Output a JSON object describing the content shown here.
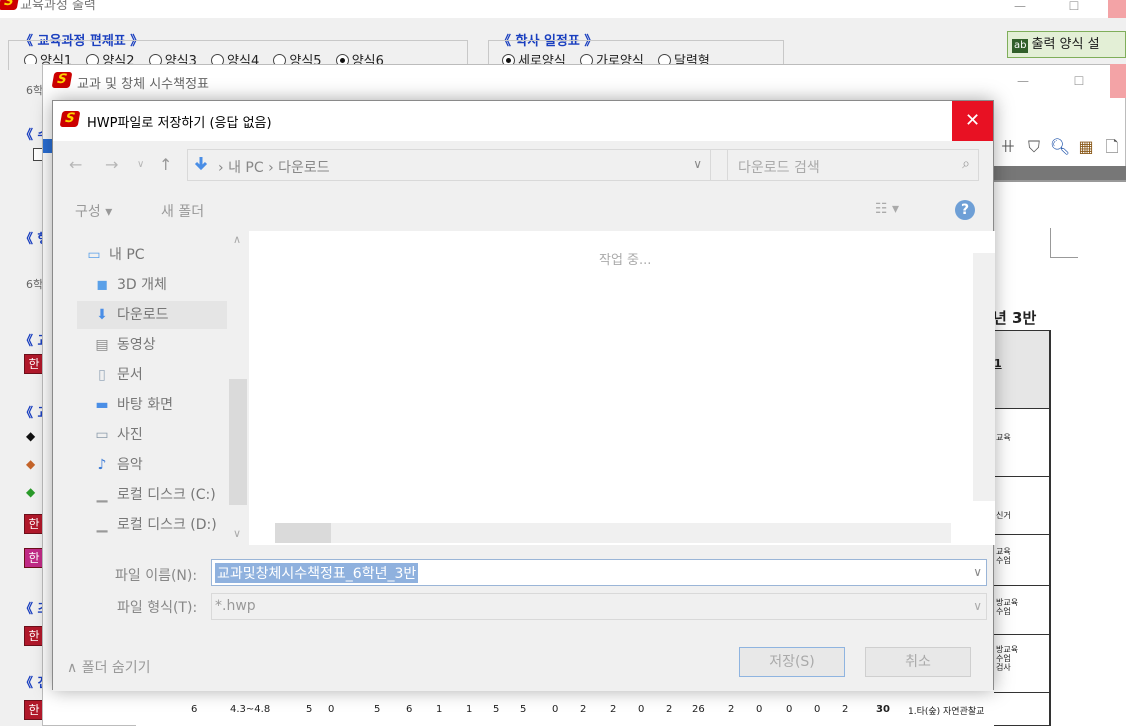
{
  "main_window": {
    "title": "교육과정 출력",
    "curriculum_group": {
      "label": "《 교육과정 편제표 》",
      "options": [
        "양식1",
        "양식2",
        "양식3",
        "양식4",
        "양식5",
        "양식6"
      ],
      "selected": "양식6"
    },
    "schedule_group": {
      "label": "《 학사 일정표 》",
      "options": [
        "세로양식",
        "가로양식",
        "달력형"
      ],
      "selected": "세로양식"
    },
    "print_settings_button": "출력 양식 설",
    "print_settings_badge": "ab",
    "side_labels": [
      "6학",
      "《 수",
      "《 행",
      "6학",
      "《 교",
      "《 교",
      "《 즈",
      "《 진"
    ],
    "red_button_glyph": "한"
  },
  "second_window": {
    "title": "교과 및 창체 시수책정표",
    "class_label": "년 3반",
    "table_cells": [
      "1",
      "교육",
      "신거",
      "교육\n수업",
      "방교육\n수업",
      "방교육\n수업\n검사"
    ],
    "bottom_row": [
      "6",
      "4.3~4.8",
      "5",
      "0",
      "5",
      "6",
      "1",
      "1",
      "5",
      "5",
      "0",
      "2",
      "2",
      "0",
      "2",
      "26",
      "2",
      "0",
      "0",
      "0",
      "2",
      "30",
      "1.타(숲) 자연관찰교"
    ]
  },
  "dialog": {
    "title": "HWP파일로 저장하기 (응답 없음)",
    "address_path": [
      "내 PC",
      "다운로드"
    ],
    "search_placeholder": "다운로드 검색",
    "commands": {
      "organize": "구성 ▾",
      "new_folder": "새 폴더"
    },
    "nav_items": [
      {
        "label": "내 PC",
        "icon": "pc-icon"
      },
      {
        "label": "3D 개체",
        "icon": "cube-icon"
      },
      {
        "label": "다운로드",
        "icon": "download-icon"
      },
      {
        "label": "동영상",
        "icon": "video-icon"
      },
      {
        "label": "문서",
        "icon": "document-icon"
      },
      {
        "label": "바탕 화면",
        "icon": "desktop-icon"
      },
      {
        "label": "사진",
        "icon": "picture-icon"
      },
      {
        "label": "음악",
        "icon": "music-icon"
      },
      {
        "label": "로컬 디스크 (C:)",
        "icon": "disk-icon"
      },
      {
        "label": "로컬 디스크 (D:)",
        "icon": "disk-icon"
      }
    ],
    "selected_nav": "다운로드",
    "working_text": "작업 중...",
    "filename_label": "파일 이름(N):",
    "filename_value": "교과및창체시수책정표_6학년_3반",
    "filetype_label": "파일 형식(T):",
    "filetype_value": "*.hwp",
    "hide_folders": "∧ 폴더 숨기기",
    "save_button": "저장(S)",
    "cancel_button": "취소"
  },
  "colors": {
    "close_red": "#e81123",
    "label_blue": "#1a3fbf",
    "selection_blue": "#8fb1de"
  }
}
